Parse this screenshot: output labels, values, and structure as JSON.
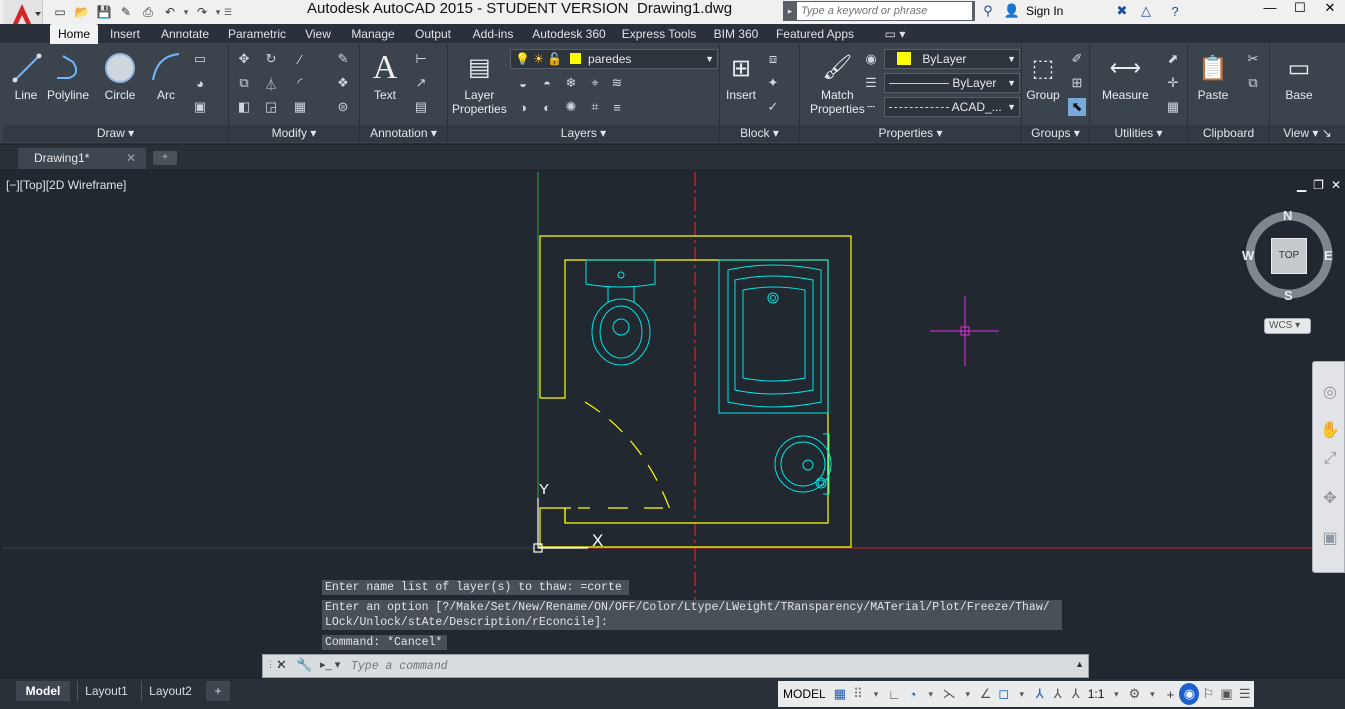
{
  "window": {
    "title": "Autodesk AutoCAD 2015 - STUDENT VERSION",
    "filename": "Drawing1.dwg",
    "search_placeholder": "Type a keyword or phrase",
    "signin": "Sign In"
  },
  "ribbon_tabs": [
    "Home",
    "Insert",
    "Annotate",
    "Parametric",
    "View",
    "Manage",
    "Output",
    "Add-ins",
    "Autodesk 360",
    "Express Tools",
    "BIM 360",
    "Featured Apps"
  ],
  "ribbon": {
    "draw": {
      "title": "Draw",
      "line": "Line",
      "polyline": "Polyline",
      "circle": "Circle",
      "arc": "Arc"
    },
    "modify": {
      "title": "Modify"
    },
    "annotation": {
      "title": "Annotation",
      "text": "Text"
    },
    "layers": {
      "title": "Layers",
      "layer_properties_1": "Layer",
      "layer_properties_2": "Properties",
      "current_layer": "paredes"
    },
    "block": {
      "title": "Block",
      "insert": "Insert"
    },
    "properties": {
      "title": "Properties",
      "match_1": "Match",
      "match_2": "Properties",
      "color": "ByLayer",
      "lineweight": "ByLayer",
      "linetype": "ACAD_..."
    },
    "groups": {
      "title": "Groups",
      "group": "Group"
    },
    "utilities": {
      "title": "Utilities",
      "measure": "Measure"
    },
    "clipboard": {
      "title": "Clipboard",
      "paste": "Paste"
    },
    "view": {
      "title": "View",
      "base": "Base"
    }
  },
  "doc_tab": {
    "label": "Drawing1*"
  },
  "viewport": {
    "label": "[−][Top][2D Wireframe]",
    "compass": {
      "n": "N",
      "s": "S",
      "e": "E",
      "w": "W",
      "top": "TOP",
      "wcs": "WCS"
    },
    "ucs": {
      "x": "X",
      "y": "Y"
    }
  },
  "command": {
    "history": [
      "Enter name list of layer(s) to thaw: =corte",
      "Enter an option [?/Make/Set/New/Rename/ON/OFF/Color/Ltype/LWeight/TRansparency/MATerial/Plot/Freeze/Thaw/",
      "LOck/Unlock/stAte/Description/rEconcile]:",
      "Command: *Cancel*"
    ],
    "placeholder": "Type a command"
  },
  "layout_tabs": [
    "Model",
    "Layout1",
    "Layout2"
  ],
  "status": {
    "model": "MODEL",
    "scale": "1:1"
  },
  "colors": {
    "wall": "#ffff00",
    "fixture": "#00e5e5",
    "cursor": "#e030e0",
    "axis_y": "#2fa84a",
    "axis_x": "#c0262e"
  }
}
